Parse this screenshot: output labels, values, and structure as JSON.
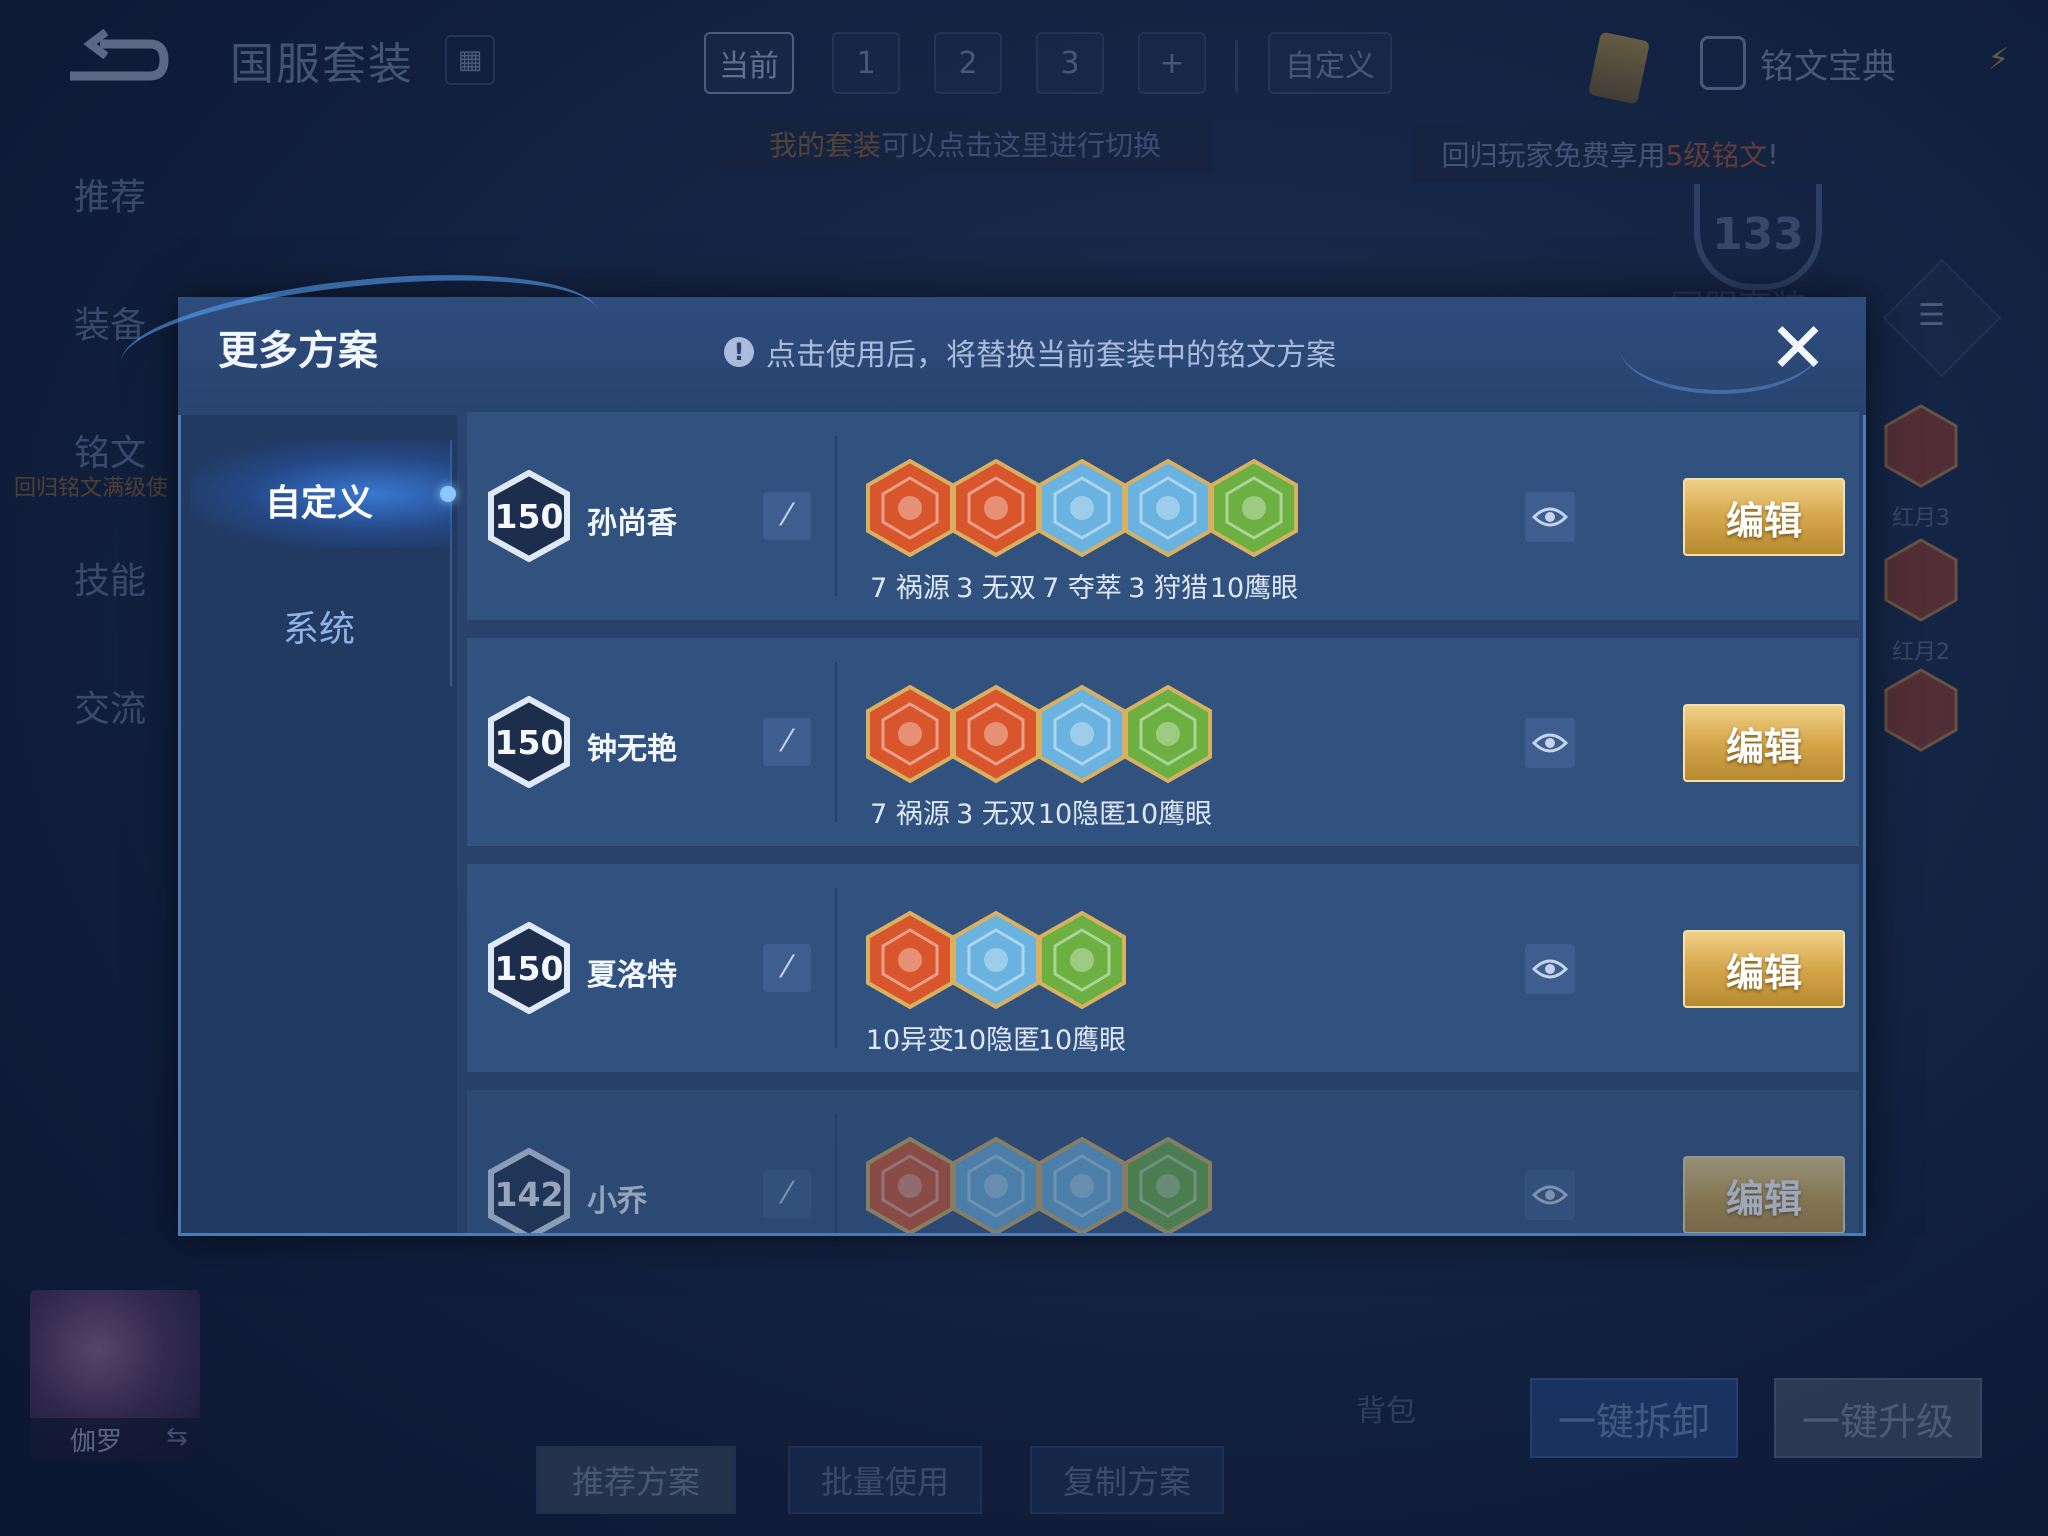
{
  "topbar": {
    "title": "国服套装",
    "tabs": [
      "当前",
      "1",
      "2",
      "3",
      "+"
    ],
    "custom_tab": "自定义",
    "hint_highlight": "我的套装",
    "hint_rest": "可以点击这里进行切换",
    "codex": "铭文宝典",
    "promo_pre": "回归玩家免费享用",
    "promo_highlight": "5级铭文",
    "promo_post": "!",
    "badge_level": "133",
    "faint_label": "国服套装"
  },
  "left_nav": {
    "items": [
      "推荐",
      "装备",
      "铭文",
      "技能",
      "交流"
    ],
    "sub_note": "回归铭文满级使"
  },
  "right_runes": [
    "红月3",
    "红月2"
  ],
  "dialog": {
    "title": "更多方案",
    "notice": "点击使用后，将替换当前套装中的铭文方案",
    "close_glyph": "✕",
    "side_tabs": [
      "自定义",
      "系统"
    ],
    "edit_label": "编辑",
    "rows": [
      {
        "level": "150",
        "hero": "孙尚香",
        "runes": [
          {
            "label": "7 祸源",
            "color": "#d9552c",
            "icon": "red-rune-icon"
          },
          {
            "label": "3 无双",
            "color": "#d9552c",
            "icon": "red-rune-icon"
          },
          {
            "label": "7 夺萃",
            "color": "#6ab3e0",
            "icon": "blue-rune-icon"
          },
          {
            "label": "3 狩猎",
            "color": "#6ab3e0",
            "icon": "blue-rune-icon"
          },
          {
            "label": "10鹰眼",
            "color": "#6bb040",
            "icon": "green-rune-icon"
          }
        ]
      },
      {
        "level": "150",
        "hero": "钟无艳",
        "runes": [
          {
            "label": "7 祸源",
            "color": "#d9552c",
            "icon": "red-rune-icon"
          },
          {
            "label": "3 无双",
            "color": "#d9552c",
            "icon": "red-rune-icon"
          },
          {
            "label": "10隐匿",
            "color": "#6ab3e0",
            "icon": "blue-rune-icon"
          },
          {
            "label": "10鹰眼",
            "color": "#6bb040",
            "icon": "green-rune-icon"
          }
        ]
      },
      {
        "level": "150",
        "hero": "夏洛特",
        "runes": [
          {
            "label": "10异变",
            "color": "#d9552c",
            "icon": "red-rune-icon"
          },
          {
            "label": "10隐匿",
            "color": "#6ab3e0",
            "icon": "blue-rune-icon"
          },
          {
            "label": "10鹰眼",
            "color": "#6bb040",
            "icon": "green-rune-icon"
          }
        ]
      },
      {
        "level": "142",
        "hero": "小乔",
        "runes": [
          {
            "label": "",
            "color": "#d9552c",
            "icon": "red-rune-icon"
          },
          {
            "label": "",
            "color": "#6ab3e0",
            "icon": "blue-rune-icon"
          },
          {
            "label": "",
            "color": "#6ab3e0",
            "icon": "blue-rune-icon"
          },
          {
            "label": "",
            "color": "#6bb040",
            "icon": "green-rune-icon"
          }
        ]
      }
    ]
  },
  "bottom": {
    "avatar_name": "伽罗",
    "buttons": [
      "推荐方案",
      "批量使用",
      "复制方案"
    ],
    "bag": "背包",
    "disassemble": "一键拆卸",
    "upgrade": "一键升级"
  }
}
